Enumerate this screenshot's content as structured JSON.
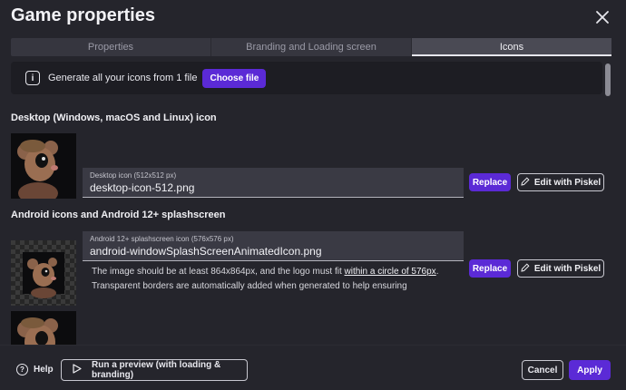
{
  "dialog": {
    "title": "Game properties"
  },
  "tabs": [
    {
      "label": "Properties",
      "active": false
    },
    {
      "label": "Branding and Loading screen",
      "active": false
    },
    {
      "label": "Icons",
      "active": true
    }
  ],
  "banner": {
    "icon": "info-icon",
    "text": "Generate all your icons from 1 file",
    "button_label": "Choose file"
  },
  "desktop_section": {
    "title": "Desktop (Windows, macOS and Linux) icon",
    "field_label": "Desktop icon (512x512 px)",
    "field_value": "desktop-icon-512.png",
    "replace_label": "Replace",
    "edit_label": "Edit with Piskel"
  },
  "android_section": {
    "title": "Android icons and Android 12+ splashscreen",
    "field_label": "Android 12+ splashscreen icon (576x576 px)",
    "field_value": "android-windowSplashScreenAnimatedIcon.png",
    "help_prefix": "The image should be at least 864x864px, and the logo must fit ",
    "help_link": "within a circle of 576px",
    "help_suffix": ". Transparent borders are automatically added when generated to help ensuring",
    "replace_label": "Replace",
    "edit_label": "Edit with Piskel"
  },
  "footer": {
    "help_label": "Help",
    "preview_label": "Run a preview (with loading & branding)",
    "cancel_label": "Cancel",
    "apply_label": "Apply"
  },
  "colors": {
    "background": "#25252c",
    "accent": "#5b2ad6"
  }
}
